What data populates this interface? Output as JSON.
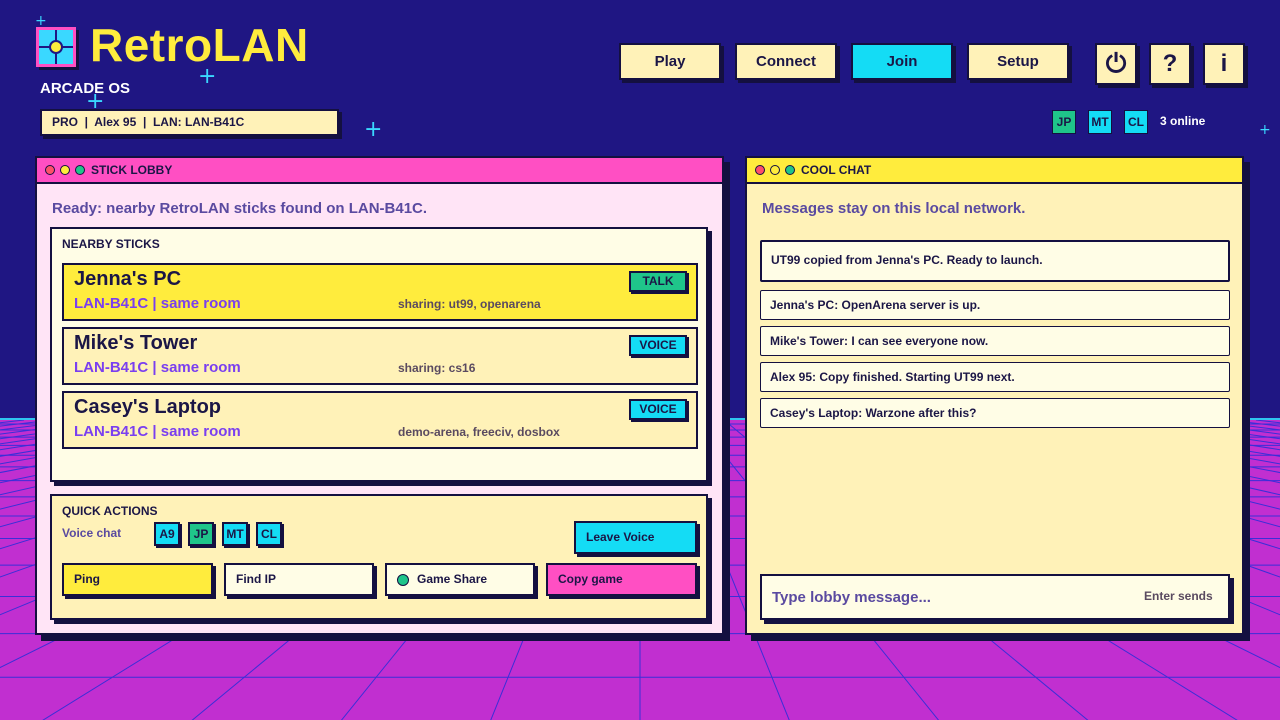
{
  "app": {
    "name": "RetroLAN",
    "subtitle": "ARCADE OS",
    "user_bar": "PRO  |  Alex 95  |  LAN: LAN-B41C"
  },
  "nav": [
    {
      "label": "Play",
      "active": false
    },
    {
      "label": "Connect",
      "active": false
    },
    {
      "label": "Join",
      "active": true
    },
    {
      "label": "Setup",
      "active": false
    }
  ],
  "icons": {
    "power": "⏻",
    "help": "?",
    "info": "i"
  },
  "presence": {
    "chips": [
      "JP",
      "MT",
      "CL"
    ],
    "online_text": "3 online"
  },
  "lobby": {
    "title": "STICK LOBBY",
    "status": "Ready: nearby RetroLAN sticks found on LAN-B41C.",
    "nearby_title": "NEARBY STICKS",
    "peers": [
      {
        "name": "Jenna's PC",
        "network": "LAN-B41C",
        "location": "same room",
        "sharing": "sharing: ut99, openarena",
        "badge": "TALK"
      },
      {
        "name": "Mike's Tower",
        "network": "LAN-B41C",
        "location": "same room",
        "sharing": "sharing: cs16",
        "badge": "VOICE"
      },
      {
        "name": "Casey's Laptop",
        "network": "LAN-B41C",
        "location": "same room",
        "sharing": "demo-arena, freeciv, dosbox",
        "badge": "VOICE"
      }
    ],
    "quick_actions": {
      "title": "QUICK ACTIONS",
      "voice_label": "Voice chat",
      "voice_chips": [
        "A9",
        "JP",
        "MT",
        "CL"
      ],
      "leave_voice": "Leave Voice",
      "buttons": [
        "Ping",
        "Find IP",
        "Game Share",
        "Copy game"
      ]
    }
  },
  "chat": {
    "title": "COOL CHAT",
    "note": "Messages stay on this local network.",
    "messages": [
      "UT99 copied from Jenna's PC. Ready to launch.",
      "Jenna's PC: OpenArena server is up.",
      "Mike's Tower: I can see everyone now.",
      "Alex 95: Copy finished. Starting UT99 next.",
      "Casey's Laptop: Warzone after this?"
    ],
    "input_placeholder": "Type lobby message...",
    "input_hint": "Enter sends"
  },
  "colors": {
    "background": "#1f1683",
    "floor": "#c12fd0",
    "grid": "#3a2fd8",
    "accent_yellow": "#ffec3d",
    "accent_cyan": "#14dcf5",
    "accent_pink": "#ff4fc3",
    "accent_green": "#1fc58a",
    "cream": "#fff2b8",
    "ink": "#141040"
  }
}
